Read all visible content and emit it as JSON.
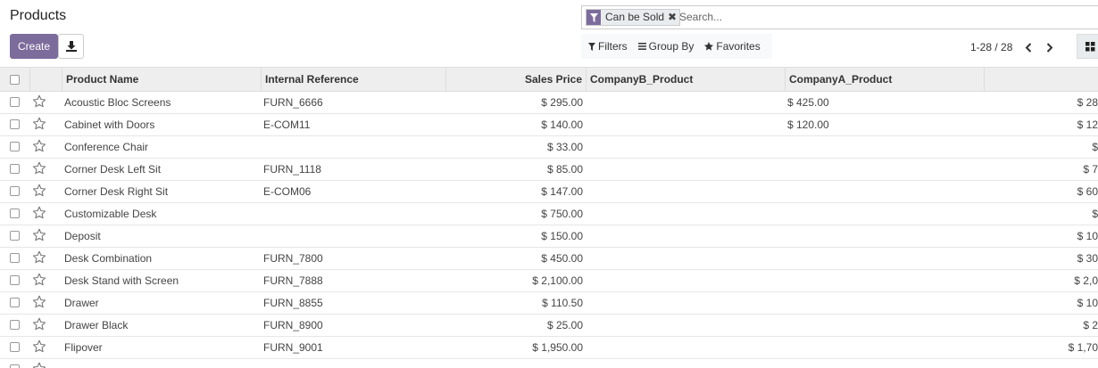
{
  "page": {
    "title": "Products"
  },
  "toolbar": {
    "create_label": "Create",
    "download_icon": "download-icon"
  },
  "search": {
    "facet_icon": "filter-icon",
    "facet_label": "Can be Sold",
    "facet_close": "✖",
    "placeholder": "Search..."
  },
  "search_options": {
    "filters_label": "Filters",
    "groupby_label": "Group By",
    "favorites_label": "Favorites"
  },
  "pager": {
    "value": "1-28 / 28"
  },
  "table": {
    "columns": {
      "name": "Product Name",
      "ref": "Internal Reference",
      "price": "Sales Price",
      "companyb": "CompanyB_Product",
      "companya": "CompanyA_Product"
    },
    "rows": [
      {
        "name": "Acoustic Bloc Screens",
        "ref": "FURN_6666",
        "price": "$ 295.00",
        "companyb": "",
        "companya": "$ 425.00",
        "extra": "$ 28"
      },
      {
        "name": "Cabinet with Doors",
        "ref": "E-COM11",
        "price": "$ 140.00",
        "companyb": "",
        "companya": "$ 120.00",
        "extra": "$ 12"
      },
      {
        "name": "Conference Chair",
        "ref": "",
        "price": "$ 33.00",
        "companyb": "",
        "companya": "",
        "extra": "$"
      },
      {
        "name": "Corner Desk Left Sit",
        "ref": "FURN_1118",
        "price": "$ 85.00",
        "companyb": "",
        "companya": "",
        "extra": "$ 7"
      },
      {
        "name": "Corner Desk Right Sit",
        "ref": "E-COM06",
        "price": "$ 147.00",
        "companyb": "",
        "companya": "",
        "extra": "$ 60"
      },
      {
        "name": "Customizable Desk",
        "ref": "",
        "price": "$ 750.00",
        "companyb": "",
        "companya": "",
        "extra": "$"
      },
      {
        "name": "Deposit",
        "ref": "",
        "price": "$ 150.00",
        "companyb": "",
        "companya": "",
        "extra": "$ 10"
      },
      {
        "name": "Desk Combination",
        "ref": "FURN_7800",
        "price": "$ 450.00",
        "companyb": "",
        "companya": "",
        "extra": "$ 30"
      },
      {
        "name": "Desk Stand with Screen",
        "ref": "FURN_7888",
        "price": "$ 2,100.00",
        "companyb": "",
        "companya": "",
        "extra": "$ 2,0"
      },
      {
        "name": "Drawer",
        "ref": "FURN_8855",
        "price": "$ 110.50",
        "companyb": "",
        "companya": "",
        "extra": "$ 10"
      },
      {
        "name": "Drawer Black",
        "ref": "FURN_8900",
        "price": "$ 25.00",
        "companyb": "",
        "companya": "",
        "extra": "$ 2"
      },
      {
        "name": "Flipover",
        "ref": "FURN_9001",
        "price": "$ 1,950.00",
        "companyb": "",
        "companya": "",
        "extra": "$ 1,70"
      },
      {
        "name": "",
        "ref": "",
        "price": "",
        "companyb": "",
        "companya": "",
        "extra": ""
      }
    ]
  },
  "colors": {
    "primary": "#7c6c9c",
    "header_bg": "#eeeeee"
  }
}
